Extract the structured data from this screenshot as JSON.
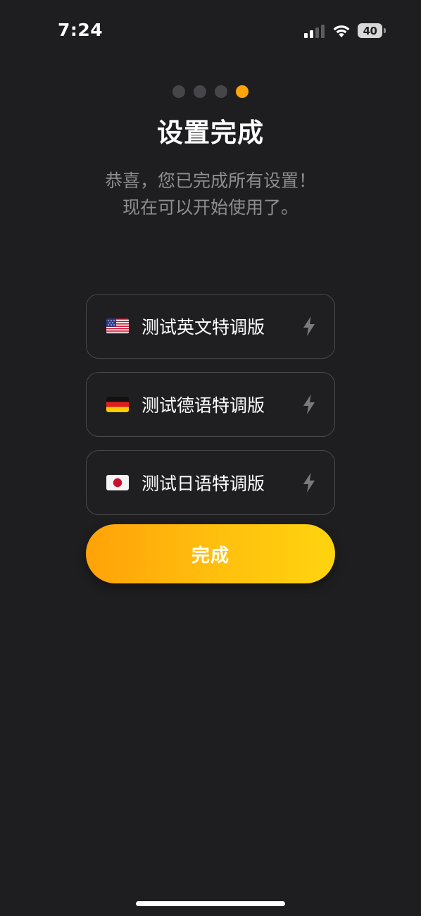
{
  "status_bar": {
    "time": "7:24",
    "battery_level": "40",
    "icons": [
      "signal-icon",
      "wifi-icon",
      "battery-icon"
    ]
  },
  "pager": {
    "total": 4,
    "current": 4
  },
  "title": "设置完成",
  "subtitle": {
    "line1": "恭喜，您已完成所有设置！",
    "line2": "现在可以开始使用了。"
  },
  "languages": [
    {
      "label": "测试英文特调版",
      "flag": "us-flag-icon",
      "icon": "bolt-icon"
    },
    {
      "label": "测试德语特调版",
      "flag": "de-flag-icon",
      "icon": "bolt-icon"
    },
    {
      "label": "测试日语特调版",
      "flag": "jp-flag-icon",
      "icon": "bolt-icon"
    }
  ],
  "done_button": {
    "label": "完成"
  },
  "colors": {
    "background": "#1e1e20",
    "accent": "#ffa40b",
    "accent_end": "#ffd40f",
    "muted_text": "#8d8d92",
    "card_border": "#49494d"
  }
}
